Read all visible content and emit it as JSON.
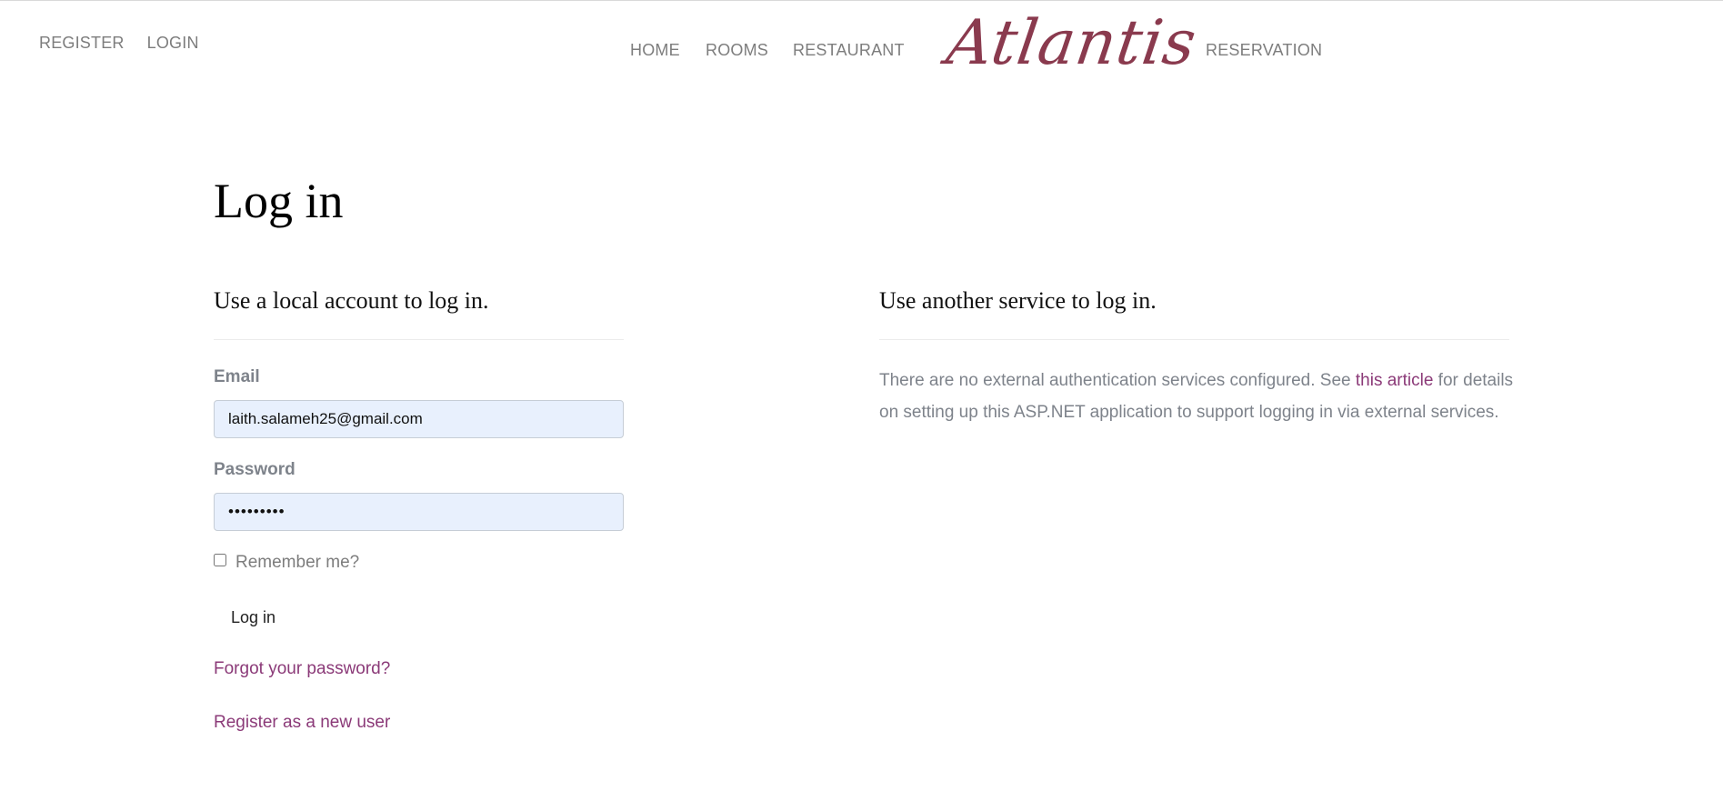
{
  "header": {
    "account_links": {
      "register": "REGISTER",
      "login": "LOGIN"
    },
    "nav": {
      "home": "HOME",
      "rooms": "ROOMS",
      "restaurant": "RESTAURANT",
      "reservation": "RESERVATION"
    },
    "logo": "Atlantis"
  },
  "main": {
    "title": "Log in",
    "local": {
      "heading": "Use a local account to log in.",
      "email_label": "Email",
      "email_value": "laith.salameh25@gmail.com",
      "password_label": "Password",
      "password_value": "123456789",
      "remember_label": "Remember me?",
      "login_button": "Log in",
      "forgot_link": "Forgot your password?",
      "register_link": "Register as a new user"
    },
    "external": {
      "heading": "Use another service to log in.",
      "text_before": "There are no external authentication services configured. See ",
      "link_text": "this article",
      "text_after": " for details on setting up this ASP.NET application to support logging in via external services."
    }
  },
  "colors": {
    "accent_link": "#8b3a78",
    "logo": "#8a3a4e",
    "input_background": "#e8f0fd"
  }
}
